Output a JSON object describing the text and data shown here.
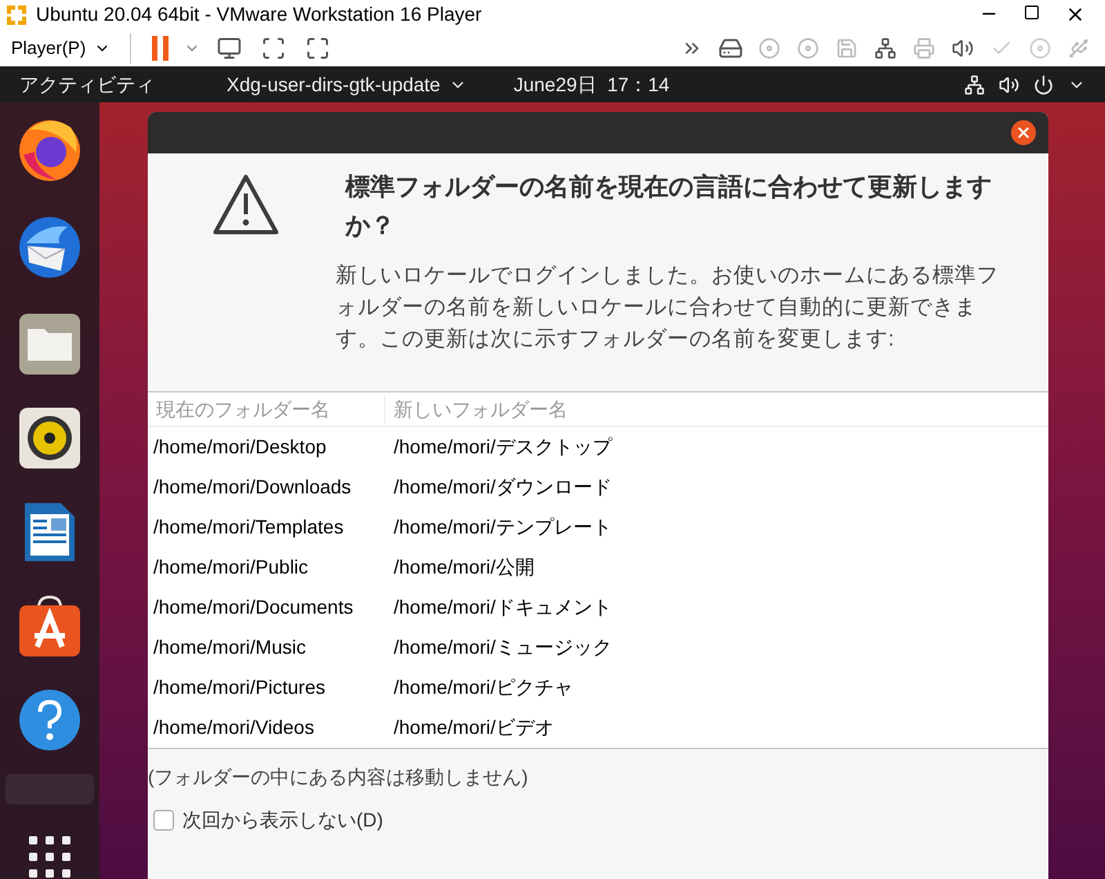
{
  "window": {
    "title": "Ubuntu 20.04 64bit - VMware Workstation 16 Player"
  },
  "toolbar": {
    "menu": "Player(P)"
  },
  "topbar": {
    "activities": "アクティビティ",
    "app_menu": "Xdg-user-dirs-gtk-update",
    "clock": "June29日  17：14"
  },
  "dialog": {
    "title": "標準フォルダーの名前を現在の言語に合わせて更新しますか？",
    "description": "新しいロケールでログインしました。お使いのホームにある標準フォルダーの名前を新しいロケールに合わせて自動的に更新できます。この更新は次に示すフォルダーの名前を変更します:",
    "table": {
      "columns": [
        "現在のフォルダー名",
        "新しいフォルダー名"
      ],
      "rows": [
        [
          "/home/mori/Desktop",
          "/home/mori/デスクトップ"
        ],
        [
          "/home/mori/Downloads",
          "/home/mori/ダウンロード"
        ],
        [
          "/home/mori/Templates",
          "/home/mori/テンプレート"
        ],
        [
          "/home/mori/Public",
          "/home/mori/公開"
        ],
        [
          "/home/mori/Documents",
          "/home/mori/ドキュメント"
        ],
        [
          "/home/mori/Music",
          "/home/mori/ミュージック"
        ],
        [
          "/home/mori/Pictures",
          "/home/mori/ピクチャ"
        ],
        [
          "/home/mori/Videos",
          "/home/mori/ビデオ"
        ]
      ]
    },
    "note": "(フォルダーの中にある内容は移動しません)",
    "checkbox": {
      "label": "次回から表示しない(D)",
      "checked": false
    }
  }
}
